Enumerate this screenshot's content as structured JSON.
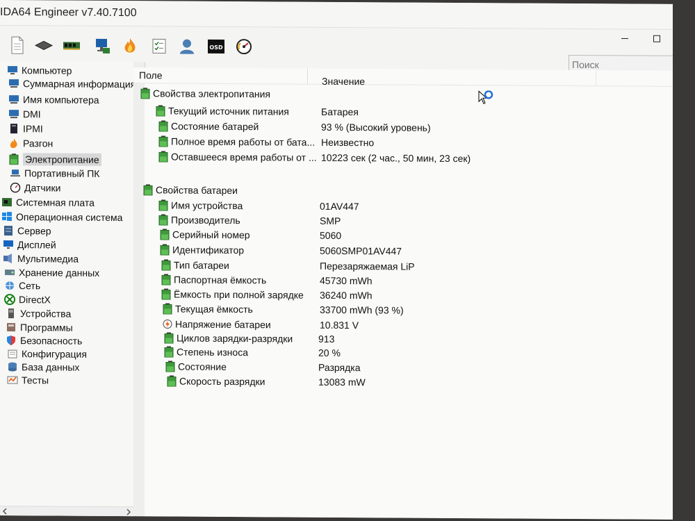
{
  "window": {
    "title": "IDA64 Engineer v7.40.7100"
  },
  "search": {
    "placeholder": "Поиск"
  },
  "tree": {
    "items": [
      {
        "label": "Компьютер",
        "icon": "computer-icon"
      },
      {
        "label": "Суммарная информация",
        "icon": "summary-icon"
      },
      {
        "label": "Имя компьютера",
        "icon": "computer-name-icon"
      },
      {
        "label": "DMI",
        "icon": "dmi-icon"
      },
      {
        "label": "IPMI",
        "icon": "ipmi-icon"
      },
      {
        "label": "Разгон",
        "icon": "flame-icon"
      },
      {
        "label": "Электропитание",
        "icon": "battery-icon"
      },
      {
        "label": "Портативный ПК",
        "icon": "laptop-icon"
      },
      {
        "label": "Датчики",
        "icon": "gauge-icon"
      },
      {
        "label": "Системная плата",
        "icon": "motherboard-icon"
      },
      {
        "label": "Операционная система",
        "icon": "windows-icon"
      },
      {
        "label": "Сервер",
        "icon": "server-icon"
      },
      {
        "label": "Дисплей",
        "icon": "monitor-icon"
      },
      {
        "label": "Мультимедиа",
        "icon": "multimedia-icon"
      },
      {
        "label": "Хранение данных",
        "icon": "storage-icon"
      },
      {
        "label": "Сеть",
        "icon": "network-icon"
      },
      {
        "label": "DirectX",
        "icon": "xbox-icon"
      },
      {
        "label": "Устройства",
        "icon": "devices-icon"
      },
      {
        "label": "Программы",
        "icon": "programs-icon"
      },
      {
        "label": "Безопасность",
        "icon": "shield-icon"
      },
      {
        "label": "Конфигурация",
        "icon": "config-icon"
      },
      {
        "label": "База данных",
        "icon": "database-icon"
      },
      {
        "label": "Тесты",
        "icon": "tests-icon"
      }
    ]
  },
  "table": {
    "columns": [
      "Поле",
      "Значение"
    ],
    "groups": [
      {
        "title": "Свойства электропитания",
        "rows": [
          {
            "field": "Текущий источник питания",
            "value": "Батарея"
          },
          {
            "field": "Состояние батарей",
            "value": "93 % (Высокий уровень)"
          },
          {
            "field": "Полное время работы от бата...",
            "value": "Неизвестно"
          },
          {
            "field": "Оставшееся время работы от ...",
            "value": "10223 сек (2 час., 50 мин, 23 сек)"
          }
        ]
      },
      {
        "title": "Свойства батареи",
        "rows": [
          {
            "field": "Имя устройства",
            "value": "01AV447"
          },
          {
            "field": "Производитель",
            "value": "SMP"
          },
          {
            "field": "Серийный номер",
            "value": "5060"
          },
          {
            "field": "Идентификатор",
            "value": "5060SMP01AV447"
          },
          {
            "field": "Тип батареи",
            "value": "Перезаряжаемая LiP"
          },
          {
            "field": "Паспортная ёмкость",
            "value": "45730 mWh"
          },
          {
            "field": "Ёмкость при полной зарядке",
            "value": "36240 mWh"
          },
          {
            "field": "Текущая ёмкость",
            "value": "33700 mWh  (93 %)"
          },
          {
            "field": "Напряжение батареи",
            "value": "10.831 V"
          },
          {
            "field": "Циклов зарядки-разрядки",
            "value": "913"
          },
          {
            "field": "Степень износа",
            "value": "20 %"
          },
          {
            "field": "Состояние",
            "value": "Разрядка"
          },
          {
            "field": "Скорость разрядки",
            "value": "13083 mW"
          }
        ]
      }
    ]
  },
  "toolbar": {
    "buttons": [
      "report-icon",
      "motherboard-icon",
      "memory-icon",
      "network-icon",
      "flame-icon",
      "checklist-icon",
      "user-icon",
      "osd-icon",
      "gauge-icon"
    ],
    "osd_label": "OSD"
  },
  "colors": {
    "accent_green": "#3f9a3c",
    "selected_bg": "#d7d7d7"
  }
}
